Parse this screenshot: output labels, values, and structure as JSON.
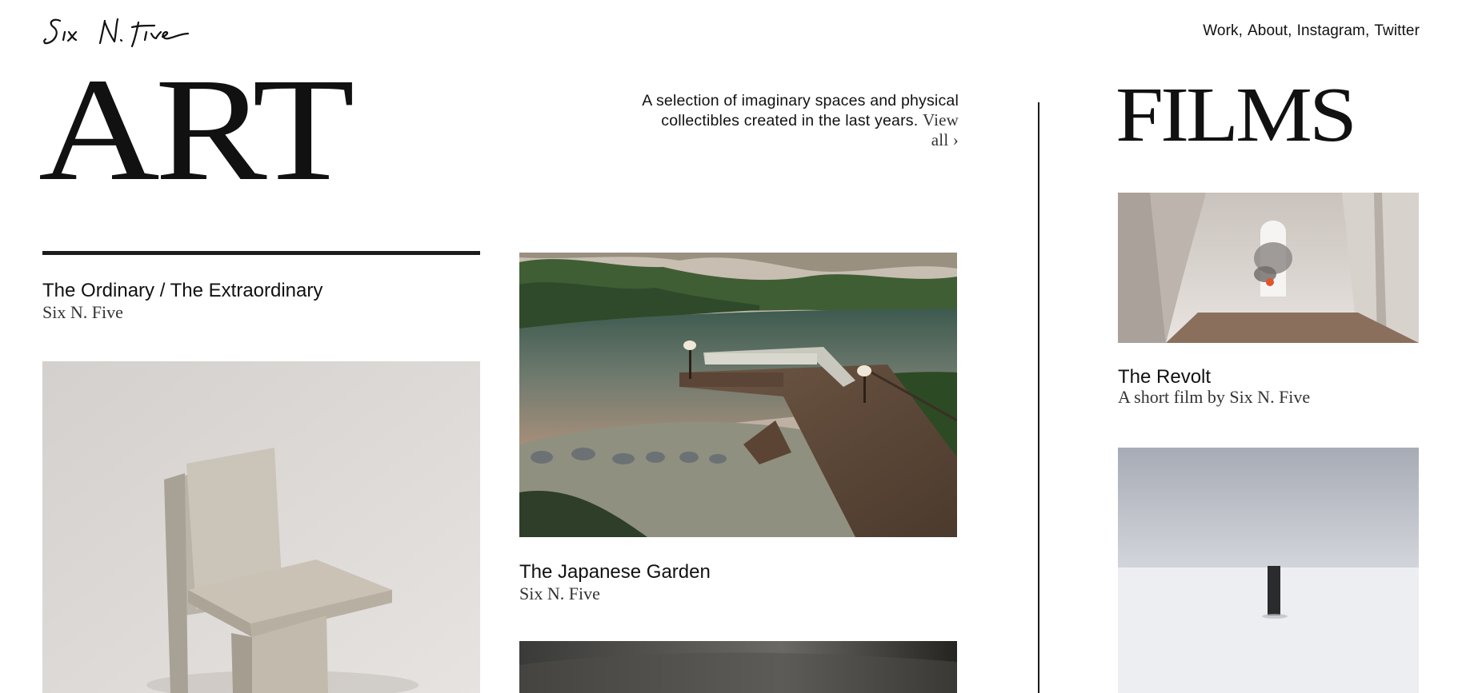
{
  "header": {
    "nav": [
      {
        "label": "Work",
        "sep": ","
      },
      {
        "label": "About",
        "sep": ","
      },
      {
        "label": "Instagram",
        "sep": ","
      },
      {
        "label": "Twitter",
        "sep": ""
      }
    ]
  },
  "art": {
    "title": "ART",
    "intro": "A selection of imaginary spaces and physical collectibles created in the last years.",
    "view_all": "View all ›",
    "items": [
      {
        "title": "The Ordinary / The Extraordinary",
        "subtitle": "Six N. Five"
      },
      {
        "title": "The Japanese Garden",
        "subtitle": "Six N. Five"
      }
    ]
  },
  "films": {
    "title": "FILMS",
    "items": [
      {
        "title": "The Revolt",
        "subtitle": "A short film by Six N. Five"
      }
    ]
  },
  "icons": {
    "logo": "six-n-five-signature-logo"
  }
}
